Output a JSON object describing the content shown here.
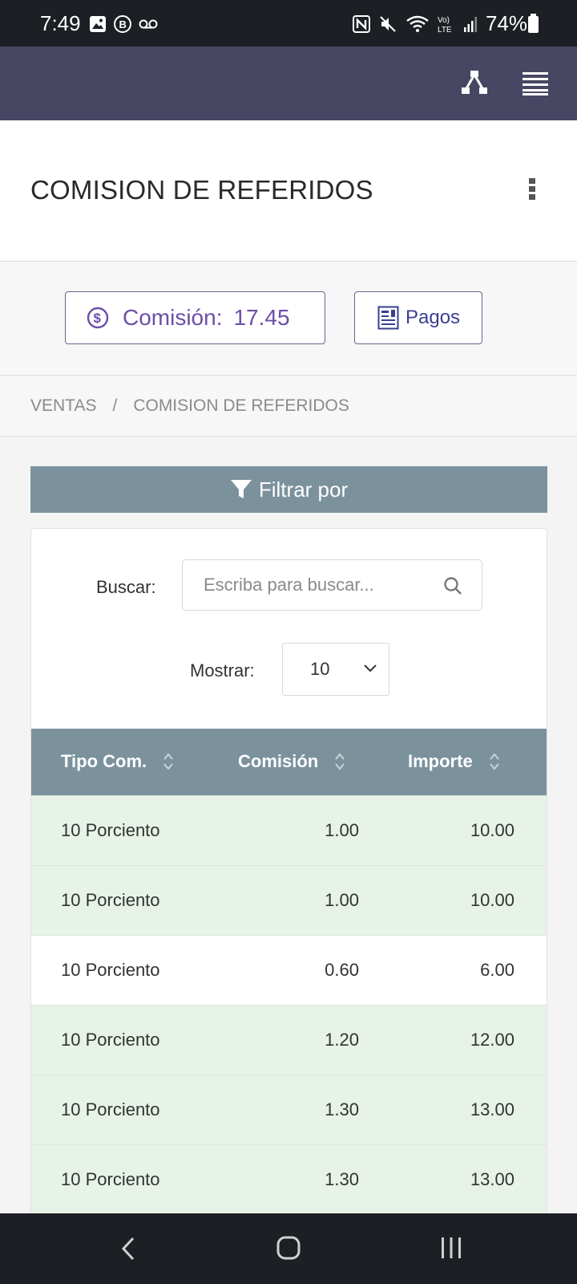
{
  "status_bar": {
    "time": "7:49",
    "battery": "74%",
    "left_icons": [
      "image-icon",
      "b-icon",
      "voicemail-icon"
    ],
    "right_icons": [
      "nfc-icon",
      "mute-icon",
      "wifi-icon",
      "volte-icon",
      "signal-icon",
      "battery-icon"
    ]
  },
  "app_bar": {
    "background": "#484763",
    "icons": [
      "network-icon",
      "menu-icon"
    ]
  },
  "header": {
    "title": "COMISION DE REFERIDOS"
  },
  "actions": {
    "comision_label": "Comisión:",
    "comision_value": "17.45",
    "pagos_label": "Pagos"
  },
  "breadcrumb": {
    "items": [
      "VENTAS",
      "COMISION DE REFERIDOS"
    ],
    "separator": "/"
  },
  "filter": {
    "label": "Filtrar por"
  },
  "search": {
    "label": "Buscar:",
    "placeholder": "Escriba para buscar..."
  },
  "show": {
    "label": "Mostrar:",
    "value": "10"
  },
  "table": {
    "headers": [
      "Tipo Com.",
      "Comisión",
      "Importe"
    ],
    "rows": [
      {
        "tipo": "10 Porciento",
        "comision": "1.00",
        "importe": "10.00"
      },
      {
        "tipo": "10 Porciento",
        "comision": "1.00",
        "importe": "10.00"
      },
      {
        "tipo": "10 Porciento",
        "comision": "0.60",
        "importe": "6.00"
      },
      {
        "tipo": "10 Porciento",
        "comision": "1.20",
        "importe": "12.00"
      },
      {
        "tipo": "10 Porciento",
        "comision": "1.30",
        "importe": "13.00"
      },
      {
        "tipo": "10 Porciento",
        "comision": "1.30",
        "importe": "13.00"
      }
    ]
  },
  "colors": {
    "accent_purple": "#6d4ea8",
    "table_header": "#7b929d",
    "row_highlight": "#e7f3e7"
  }
}
